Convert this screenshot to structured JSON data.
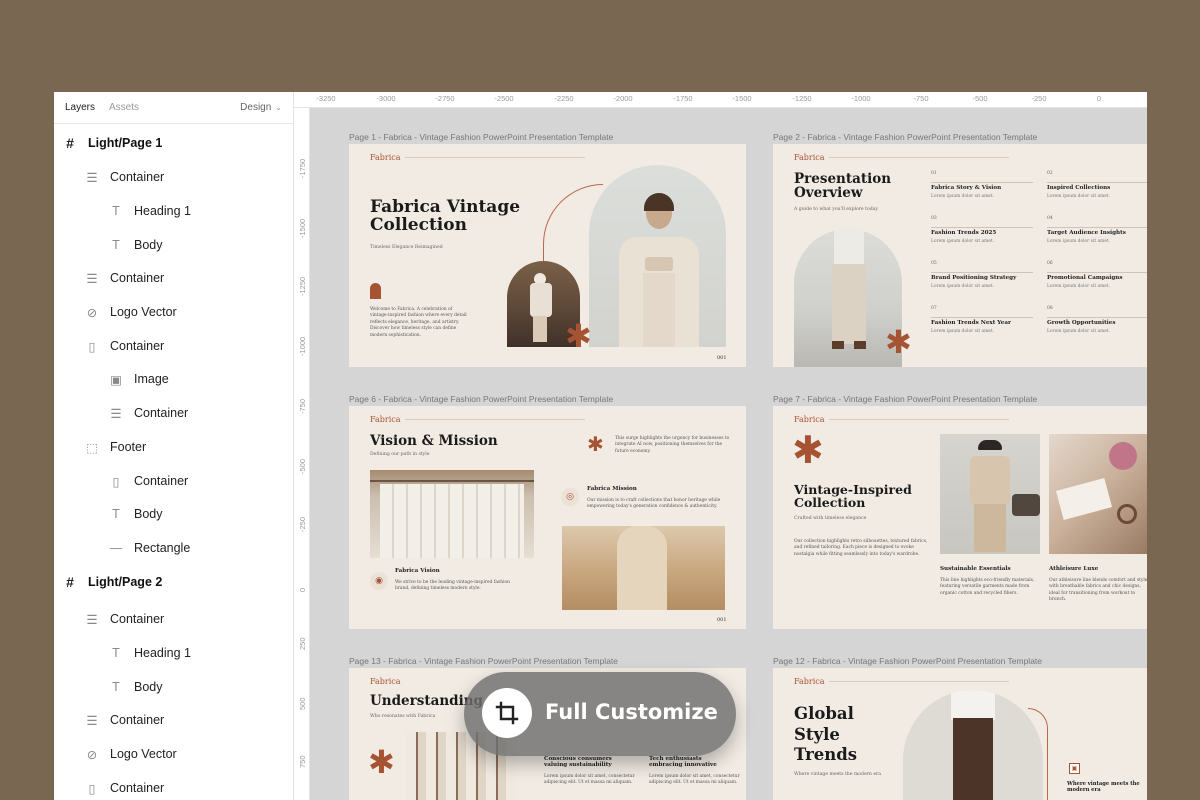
{
  "panel": {
    "tabs": [
      "Layers",
      "Assets"
    ],
    "design_label": "Design",
    "layers": [
      {
        "label": "Light/Page 1",
        "icon": "frame-icon",
        "page": true
      },
      {
        "label": "Container",
        "icon": "auto-layout-icon"
      },
      {
        "label": "Heading 1",
        "icon": "text-icon"
      },
      {
        "label": "Body",
        "icon": "text-icon"
      },
      {
        "label": "Container",
        "icon": "auto-layout-icon"
      },
      {
        "label": "Logo Vector",
        "icon": "vector-icon"
      },
      {
        "label": "Container",
        "icon": "columns-icon"
      },
      {
        "label": "Image",
        "icon": "image-icon"
      },
      {
        "label": "Container",
        "icon": "auto-layout-icon"
      },
      {
        "label": "Footer",
        "icon": "dashed-frame-icon"
      },
      {
        "label": "Container",
        "icon": "columns-icon"
      },
      {
        "label": "Body",
        "icon": "text-icon"
      },
      {
        "label": "Rectangle",
        "icon": "line-icon"
      },
      {
        "label": "Light/Page 2",
        "icon": "frame-icon",
        "page": true
      },
      {
        "label": "Container",
        "icon": "auto-layout-icon"
      },
      {
        "label": "Heading 1",
        "icon": "text-icon"
      },
      {
        "label": "Body",
        "icon": "text-icon"
      },
      {
        "label": "Container",
        "icon": "auto-layout-icon"
      },
      {
        "label": "Logo Vector",
        "icon": "vector-icon"
      },
      {
        "label": "Container",
        "icon": "columns-icon"
      }
    ]
  },
  "ruler": {
    "top": [
      "-3250",
      "-3000",
      "-2750",
      "-2500",
      "-2250",
      "-2000",
      "-1750",
      "-1500",
      "-1250",
      "-1000",
      "-750",
      "-500",
      "-250",
      "0"
    ],
    "left": [
      "-1750",
      "-1500",
      "-1250",
      "-1000",
      "-750",
      "-500",
      "-250",
      "0",
      "250",
      "500",
      "750"
    ]
  },
  "slides": {
    "s1": {
      "label": "Page 1 - Fabrica - Vintage Fashion PowerPoint Presentation Template",
      "brand": "Fabrica",
      "title1": "Fabrica Vintage",
      "title2": "Collection",
      "subtitle": "Timeless Elegance Reimagined",
      "para": "Welcome to Fabrica. A celebration of vintage-inspired fashion where every detail reflects elegance, heritage, and artistry. Discover how timeless style can define modern sophistication.",
      "page": "001"
    },
    "s2": {
      "label": "Page 2 - Fabrica - Vintage Fashion PowerPoint Presentation Template",
      "brand": "Fabrica",
      "title1": "Presentation",
      "title2": "Overview",
      "subtitle": "A guide to what you'll explore today",
      "items": [
        {
          "num": "01",
          "title": "Fabrica Story & Vision",
          "desc": "Lorem ipsum dolor sit amet."
        },
        {
          "num": "02",
          "title": "Inspired Collections",
          "desc": "Lorem ipsum dolor sit amet."
        },
        {
          "num": "03",
          "title": "Fashion Trends 2025",
          "desc": "Lorem ipsum dolor sit amet."
        },
        {
          "num": "04",
          "title": "Target Audience Insights",
          "desc": "Lorem ipsum dolor sit amet."
        },
        {
          "num": "05",
          "title": "Brand Positioning Strategy",
          "desc": "Lorem ipsum dolor sit amet."
        },
        {
          "num": "06",
          "title": "Promotional Campaigns",
          "desc": "Lorem ipsum dolor sit amet."
        },
        {
          "num": "07",
          "title": "Fashion Trends Next Year",
          "desc": "Lorem ipsum dolor sit amet."
        },
        {
          "num": "08",
          "title": "Growth Opportunities",
          "desc": "Lorem ipsum dolor sit amet."
        }
      ]
    },
    "s6": {
      "label": "Page 6 - Fabrica - Vintage Fashion PowerPoint Presentation Template",
      "brand": "Fabrica",
      "title": "Vision & Mission",
      "subtitle": "Defining our path in style",
      "intro": "This surge highlights the urgency for businesses to integrate AI now, positioning themselves for the future economy.",
      "mission_title": "Fabrica Mission",
      "mission_text": "Our mission is to craft collections that honor heritage while empowering today's generation confidence & authenticity.",
      "vision_title": "Fabrica Vision",
      "vision_text": "We strive to be the leading vintage-inspired fashion brand, defining timeless modern style.",
      "page": "001"
    },
    "s7": {
      "label": "Page 7 - Fabrica - Vintage Fashion PowerPoint Presentation Template",
      "brand": "Fabrica",
      "title1": "Vintage-Inspired",
      "title2": "Collection",
      "subtitle": "Crafted with timeless elegance",
      "para": "Our collection highlights retro silhouettes, textured fabrics, and refined tailoring. Each piece is designed to evoke nostalgia while fitting seamlessly into today's wardrobe.",
      "col1_title": "Sustainable Essentials",
      "col1_text": "This line highlights eco-friendly materials, featuring versatile garments made from organic cotton and recycled fibers.",
      "col2_title": "Athleisure Luxe",
      "col2_text": "Our athleisure line blends comfort and style with breathable fabrics and chic designs, ideal for transitioning from workout to brunch."
    },
    "s13": {
      "label": "Page 13 - Fabrica - Vintage Fashion PowerPoint Presentation Template",
      "brand": "Fabrica",
      "title": "Understanding",
      "subtitle": "Who resonates with Fabrica",
      "c1_title1": "Conscious consumers",
      "c1_title2": "valuing sustainability",
      "c1_text": "Lorem ipsum dolor sit amet, consectetur adipiscing elit. Ut et massa mi aliquam.",
      "c2_title1": "Tech enthusiasts",
      "c2_title2": "embracing innovative",
      "c2_text": "Lorem ipsum dolor sit amet, consectetur adipiscing elit. Ut et massa mi aliquam."
    },
    "s12": {
      "label": "Page 12 - Fabrica - Vintage Fashion PowerPoint Presentation Template",
      "brand": "Fabrica",
      "title1": "Global",
      "title2": "Style",
      "title3": "Trends",
      "subtitle": "Where vintage meets the modern era",
      "side1": "Where vintage meets the",
      "side2": "modern era"
    }
  },
  "badge": {
    "label": "Full Customize",
    "icon": "crop-icon"
  },
  "colors": {
    "accent": "#a55333",
    "slide_bg": "#f1ebe3",
    "canvas_bg": "#d5d5d5",
    "outer_bg": "#7a6752"
  }
}
